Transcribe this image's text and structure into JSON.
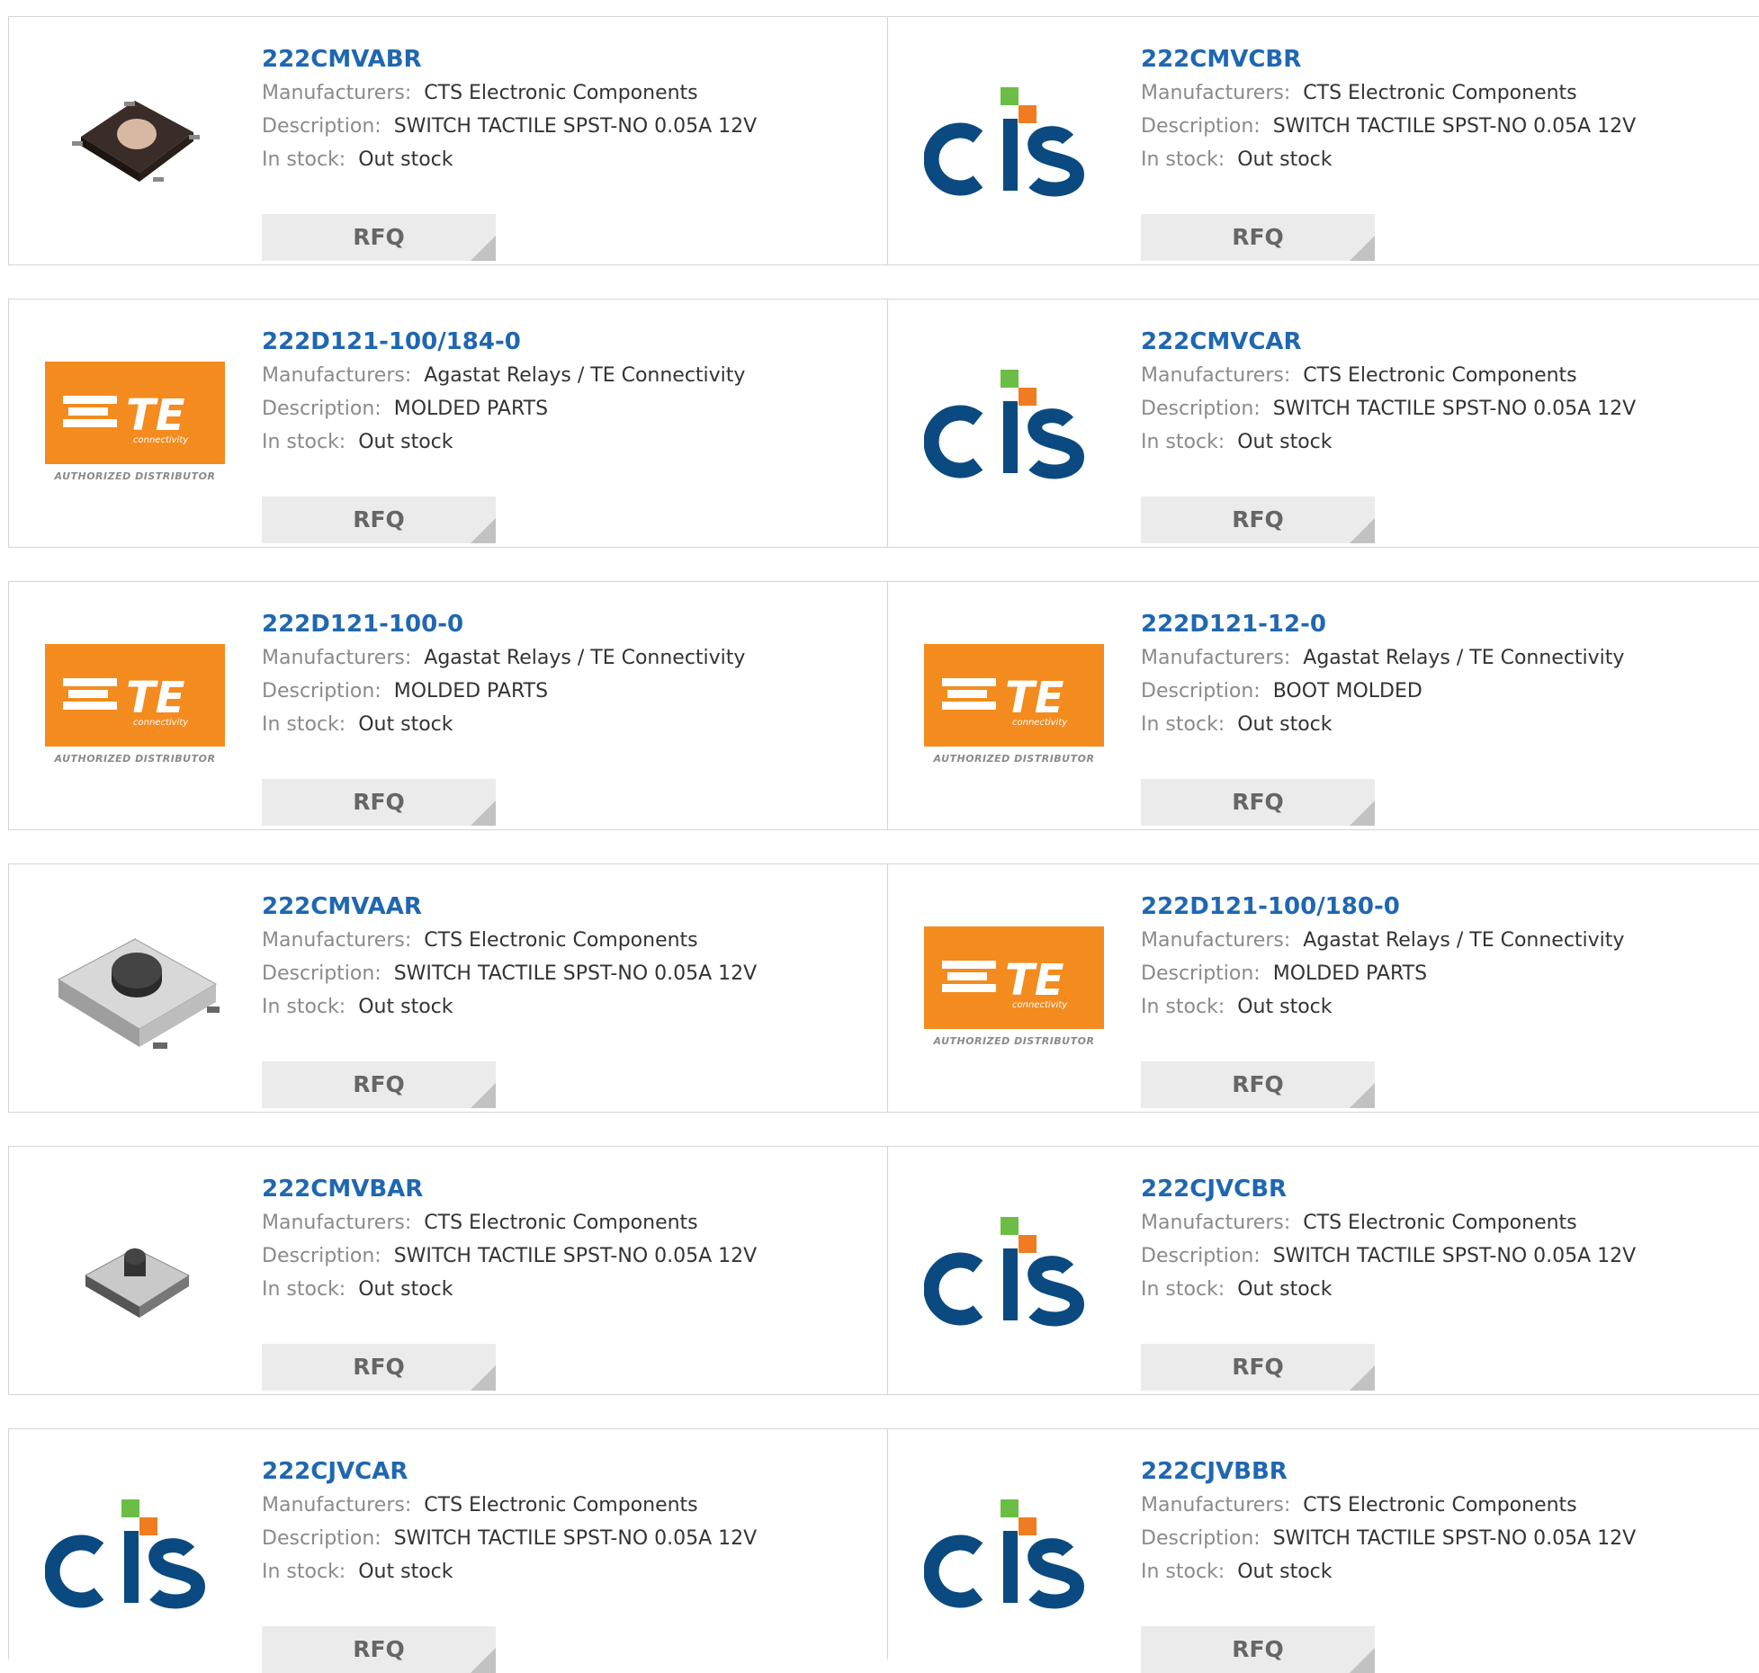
{
  "labels": {
    "manufacturers": "Manufacturers:",
    "description": "Description:",
    "stock": "In stock:",
    "rfq": "RFQ"
  },
  "logos": {
    "cts_text": "cts",
    "te_text": "TE",
    "te_sub": "connectivity",
    "te_authorized": "AUTHORIZED DISTRIBUTOR"
  },
  "colors": {
    "link": "#1f67b1",
    "cts_blue": "#0b4a80",
    "cts_orange": "#f07c22",
    "cts_green": "#6cbd45",
    "te_orange": "#f38b1f"
  },
  "products": [
    {
      "part": "222CMVABR",
      "manufacturer": "CTS Electronic Components",
      "description": "SWITCH TACTILE SPST-NO 0.05A 12V",
      "stock": "Out stock",
      "image": "tactile-switch-brown-icon"
    },
    {
      "part": "222CMVCBR",
      "manufacturer": "CTS Electronic Components",
      "description": "SWITCH TACTILE SPST-NO 0.05A 12V",
      "stock": "Out stock",
      "image": "cts-logo"
    },
    {
      "part": "222D121-100/184-0",
      "manufacturer": "Agastat Relays / TE Connectivity",
      "description": "MOLDED PARTS",
      "stock": "Out stock",
      "image": "te-logo"
    },
    {
      "part": "222CMVCAR",
      "manufacturer": "CTS Electronic Components",
      "description": "SWITCH TACTILE SPST-NO 0.05A 12V",
      "stock": "Out stock",
      "image": "cts-logo"
    },
    {
      "part": "222D121-100-0",
      "manufacturer": "Agastat Relays / TE Connectivity",
      "description": "MOLDED PARTS",
      "stock": "Out stock",
      "image": "te-logo"
    },
    {
      "part": "222D121-12-0",
      "manufacturer": "Agastat Relays / TE Connectivity",
      "description": "BOOT MOLDED",
      "stock": "Out stock",
      "image": "te-logo"
    },
    {
      "part": "222CMVAAR",
      "manufacturer": "CTS Electronic Components",
      "description": "SWITCH TACTILE SPST-NO 0.05A 12V",
      "stock": "Out stock",
      "image": "tactile-switch-large-icon"
    },
    {
      "part": "222D121-100/180-0",
      "manufacturer": "Agastat Relays / TE Connectivity",
      "description": "MOLDED PARTS",
      "stock": "Out stock",
      "image": "te-logo"
    },
    {
      "part": "222CMVBAR",
      "manufacturer": "CTS Electronic Components",
      "description": "SWITCH TACTILE SPST-NO 0.05A 12V",
      "stock": "Out stock",
      "image": "tactile-switch-small-icon"
    },
    {
      "part": "222CJVCBR",
      "manufacturer": "CTS Electronic Components",
      "description": "SWITCH TACTILE SPST-NO 0.05A 12V",
      "stock": "Out stock",
      "image": "cts-logo"
    },
    {
      "part": "222CJVCAR",
      "manufacturer": "CTS Electronic Components",
      "description": "SWITCH TACTILE SPST-NO 0.05A 12V",
      "stock": "Out stock",
      "image": "cts-logo"
    },
    {
      "part": "222CJVBBR",
      "manufacturer": "CTS Electronic Components",
      "description": "SWITCH TACTILE SPST-NO 0.05A 12V",
      "stock": "Out stock",
      "image": "cts-logo"
    }
  ]
}
